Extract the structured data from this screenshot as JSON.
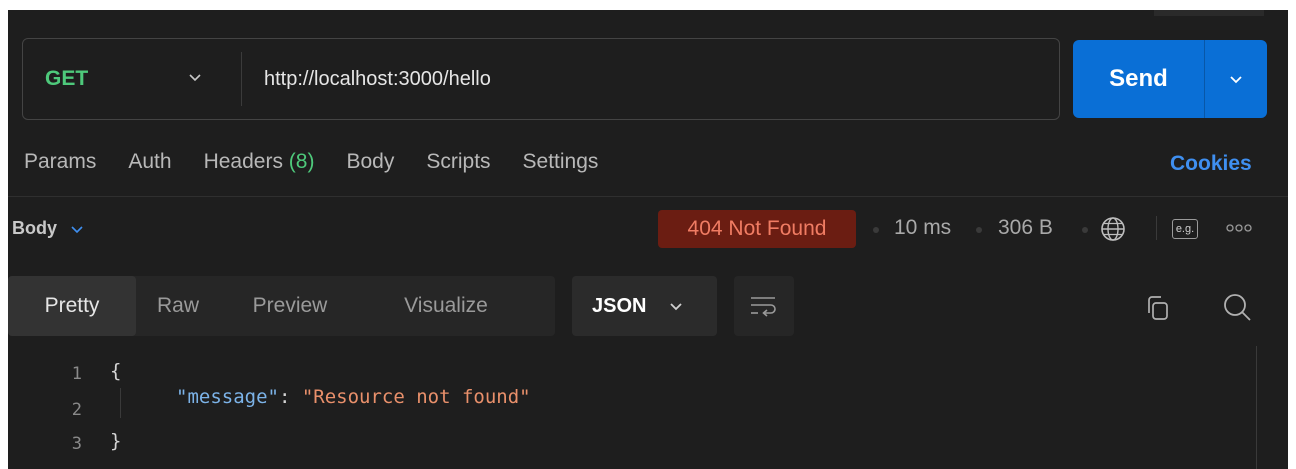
{
  "request": {
    "method": "GET",
    "url": "http://localhost:3000/hello",
    "send_label": "Send"
  },
  "request_tabs": [
    {
      "label": "Params"
    },
    {
      "label": "Auth"
    },
    {
      "label": "Headers",
      "count": "(8)"
    },
    {
      "label": "Body"
    },
    {
      "label": "Scripts"
    },
    {
      "label": "Settings"
    }
  ],
  "cookies_label": "Cookies",
  "response": {
    "section_label": "Body",
    "status": "404 Not Found",
    "time": "10 ms",
    "size": "306 B",
    "example_badge": "e.g."
  },
  "view_tabs": [
    {
      "label": "Pretty",
      "active": true
    },
    {
      "label": "Raw"
    },
    {
      "label": "Preview"
    },
    {
      "label": "Visualize"
    }
  ],
  "format": "JSON",
  "code": {
    "lines": [
      "1",
      "2",
      "3"
    ],
    "open_brace": "{",
    "close_brace": "}",
    "key": "\"message\"",
    "colon": ": ",
    "value": "\"Resource not found\""
  },
  "colors": {
    "method_get": "#4ec97b",
    "send_button": "#0a6fd6",
    "status_error_bg": "#6b1d12",
    "status_error_text": "#f07c63",
    "link_blue": "#3f8ff0"
  }
}
